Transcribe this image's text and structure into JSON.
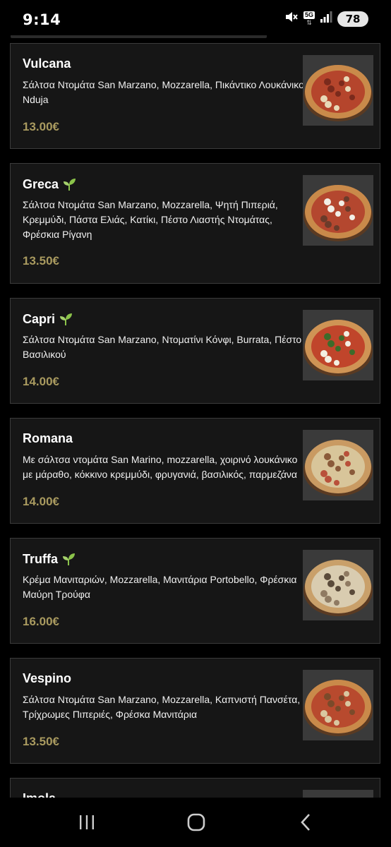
{
  "status_bar": {
    "time": "9:14",
    "network": "5G",
    "battery": "78",
    "icons": [
      "mute-icon",
      "5g-icon",
      "signal-icon",
      "battery-icon"
    ]
  },
  "menu": {
    "items": [
      {
        "name": "Vulcana",
        "vegetarian": false,
        "description": "Σάλτσα Ντομάτα San Marzano, Mozzarella, Πικάντικο Λουκάνικο Nduja",
        "price": "13.00€"
      },
      {
        "name": "Greca",
        "vegetarian": true,
        "description": "Σάλτσα Ντομάτα San Marzano, Mozzarella, Ψητή Πιπεριά, Κρεμμύδι, Πάστα Ελιάς, Κατίκι, Πέστο Λιαστής Ντομάτας, Φρέσκια Ρίγανη",
        "price": "13.50€"
      },
      {
        "name": "Capri",
        "vegetarian": true,
        "description": "Σάλτσα Ντομάτα San Marzano, Ντοματίνι Κόνφι, Burrata, Πέστο Βασιλικού",
        "price": "14.00€"
      },
      {
        "name": "Romana",
        "vegetarian": false,
        "description": "Με σάλτσα ντομάτα San Marino, mozzarella, χοιρινό λουκάνικο με μάραθο, κόκκινο κρεμμύδι, φρυγανιά, βασιλικός, παρμεζάνα",
        "price": "14.00€"
      },
      {
        "name": "Truffa",
        "vegetarian": true,
        "description": "Κρέμα Μανιταριών, Mozzarella, Μανιτάρια Portobello, Φρέσκια Μαύρη Τρούφα",
        "price": "16.00€"
      },
      {
        "name": "Vespino",
        "vegetarian": false,
        "description": "Σάλτσα Ντομάτα San Marzano, Mozzarella, Καπνιστή Πανσέτα, Τρίχρωμες Πιπεριές, Φρέσκα Μανιτάρια",
        "price": "13.50€"
      },
      {
        "name": "Imola",
        "vegetarian": false,
        "description": "",
        "price": ""
      }
    ]
  },
  "colors": {
    "background": "#000000",
    "card": "#161616",
    "card_border": "#3b3b3b",
    "price": "#a99a5f",
    "veg_leaf": "#8bc34a"
  },
  "nav_bar": {
    "icons": [
      "recent-apps-icon",
      "home-icon",
      "back-icon"
    ]
  }
}
